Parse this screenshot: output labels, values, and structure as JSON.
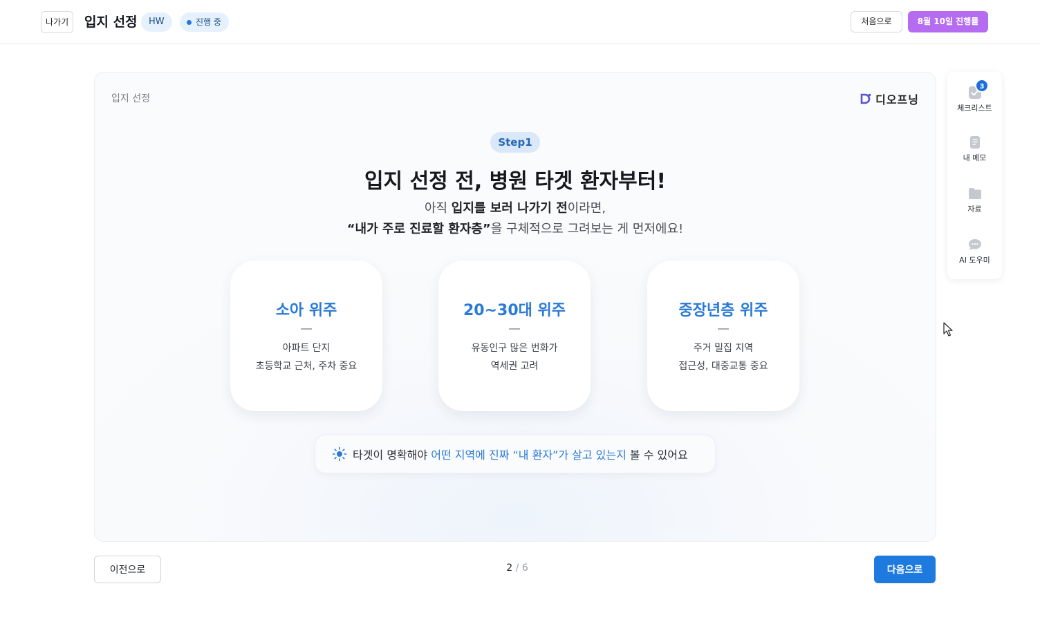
{
  "header": {
    "exit_label": "나가기",
    "title": "입지 선정",
    "tag": "HW",
    "status": "진행 중",
    "restart_label": "처음으로",
    "progress_label": "8월 10일 진행률"
  },
  "slide": {
    "label": "입지 선정",
    "logo_text": "디오프닝",
    "step": "Step1",
    "headline": "입지 선정 전, 병원 타겟 환자부터!",
    "sub1_a": "아직 ",
    "sub1_b": "입지를 보러 나가기 전",
    "sub1_c": "이라면,",
    "sub2_a": "“내가 주로 진료할 환자층”",
    "sub2_b": "을 구체적으로 그려보는 게 먼저에요!",
    "cards": [
      {
        "title": "소아 위주",
        "line1": "아파트 단지",
        "line2": "초등학교 근처, 주차 중요"
      },
      {
        "title": "20~30대 위주",
        "line1": "유동인구 많은 번화가",
        "line2": "역세권 고려"
      },
      {
        "title": "중장년층 위주",
        "line1": "주거 밀집 지역",
        "line2": "접근성, 대중교통 중요"
      }
    ],
    "tip_a": "타겟이 명확해야 ",
    "tip_b": "어떤 지역에 진짜 “내 환자”가 살고 있는지",
    "tip_c": " 볼 수 있어요",
    "tip_icon": "sun-icon"
  },
  "footer": {
    "prev_label": "이전으로",
    "page_current": "2",
    "page_sep": "/",
    "page_total": "6",
    "next_label": "다음으로"
  },
  "sidebar": {
    "checklist_count": "3",
    "items": [
      {
        "label": "체크리스트",
        "icon": "checklist-icon"
      },
      {
        "label": "내 메모",
        "icon": "memo-icon"
      },
      {
        "label": "자료",
        "icon": "folder-icon"
      },
      {
        "label": "AI 도우미",
        "icon": "chat-icon"
      }
    ]
  },
  "colors": {
    "accent": "#1f7ae0",
    "progress": "#b56cf0",
    "card_title": "#2a7ad6"
  }
}
